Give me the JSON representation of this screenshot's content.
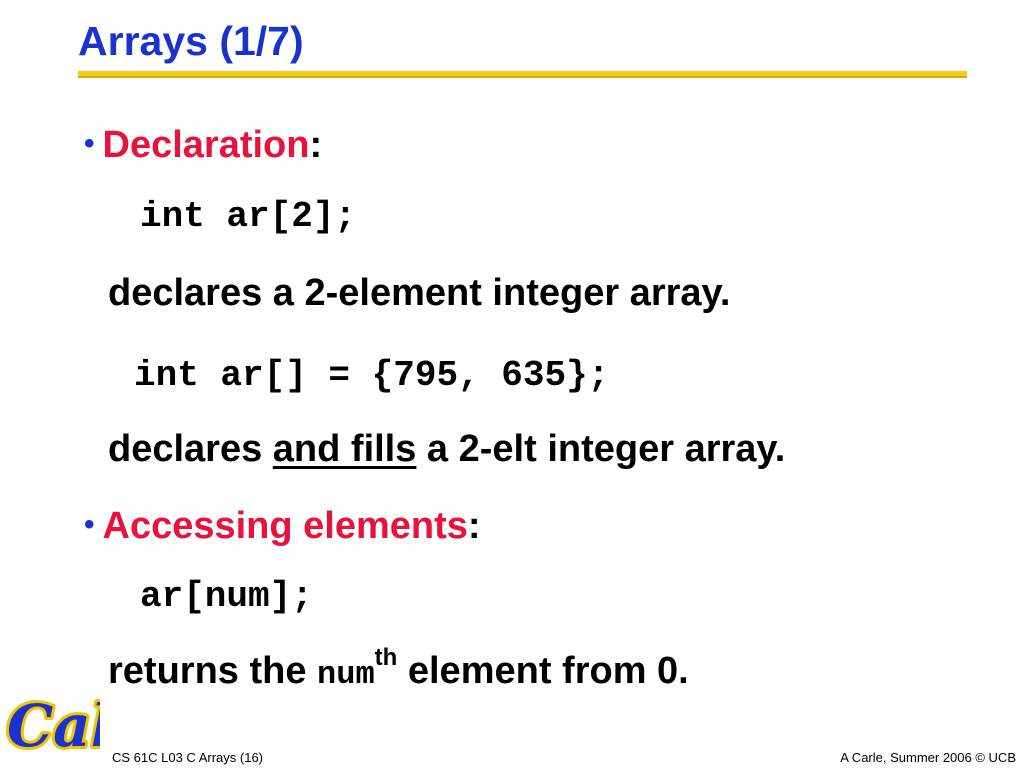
{
  "title": "Arrays (1/7)",
  "colors": {
    "title": "#1a33cc",
    "accent_red": "#e8123c",
    "rule_yellow": "#f5cc1e",
    "logo_blue": "#1a33cc",
    "logo_gold": "#f2c500"
  },
  "bullets": [
    {
      "heading": "Declaration",
      "colon": ":"
    },
    {
      "heading": "Accessing elements",
      "colon": ":"
    }
  ],
  "code": {
    "decl1": "int ar[2];",
    "decl2": "int ar[] = {795, 635};",
    "access": "ar[num];"
  },
  "lines": {
    "line1": "declares a 2-element integer array.",
    "line2_pre": "declares ",
    "line2_underlined": "and fills",
    "line2_post": " a 2-elt integer array.",
    "line3_pre": "returns the ",
    "line3_mono": "num",
    "line3_sup": "th",
    "line3_post": " element from 0."
  },
  "logo": {
    "icon": "cal-logo-icon",
    "text": "Cal"
  },
  "footer": {
    "left": "CS 61C L03 C Arrays (16)",
    "right": "A Carle, Summer 2006 © UCB"
  }
}
